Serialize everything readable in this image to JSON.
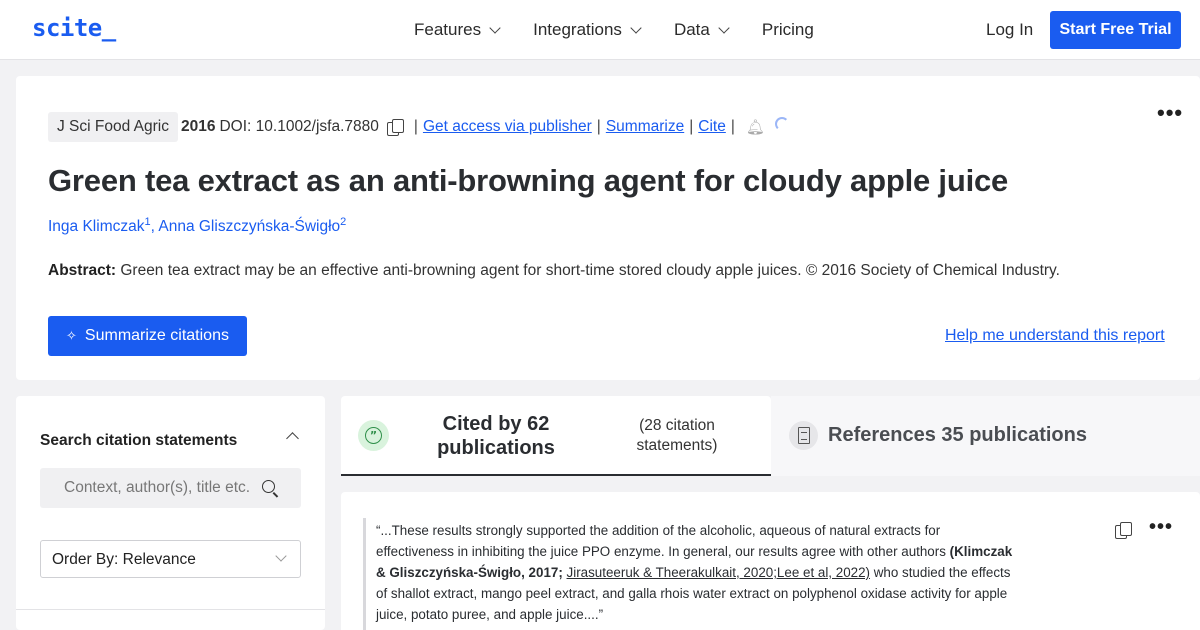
{
  "nav": {
    "logo": "scite_",
    "menu": [
      "Features",
      "Integrations",
      "Data",
      "Pricing"
    ],
    "login": "Log In",
    "trial": "Start Free Trial"
  },
  "paper": {
    "journal": "J Sci Food Agric",
    "year": "2016",
    "doi": "DOI: 10.1002/jsfa.7880",
    "links": [
      "Get access via publisher",
      "Summarize",
      "Cite"
    ],
    "title": "Green tea extract as an anti-browning agent for cloudy apple juice",
    "authors": [
      {
        "name": "Inga Klimczak",
        "sup": "1"
      },
      {
        "name": "Anna Gliszczyńska-Świgło",
        "sup": "2"
      }
    ],
    "abstract_label": "Abstract:",
    "abstract_text": " Green tea extract may be an effective anti-browning agent for short-time stored cloudy apple juices. © 2016 Society of Chemical Industry.",
    "summarize_button": "Summarize citations",
    "help_link": "Help me understand this report"
  },
  "left_panel": {
    "title": "Search citation statements",
    "search_placeholder": "Context, author(s), title etc.",
    "order_by": "Order By: Relevance"
  },
  "tabs": {
    "cited_main": "Cited by 62 publications",
    "cited_sub": "(28 citation statements)",
    "references": "References 35 publications"
  },
  "citation": {
    "part1": "“...These results strongly supported the addition of the alcoholic, aqueous of natural extracts for effectiveness in inhibiting the juice PPO enzyme. In general, our results agree with other authors ",
    "bold": "(Klimczak & Gliszczyńska-Świgło, 2017;",
    "link": "Jirasuteeruk & Theerakulkait, 2020;Lee et al, 2022)",
    "part2": " who studied the effects of shallot extract, mango peel extract, and galla rhois water extract on polyphenol oxidase activity for apple juice, potato puree, and apple juice....”"
  }
}
